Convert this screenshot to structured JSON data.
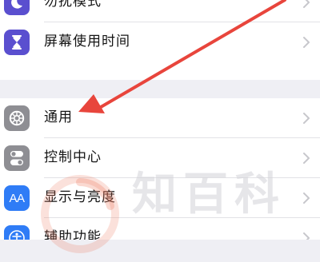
{
  "settings": {
    "group1": [
      {
        "label": "勿扰模式",
        "icon": "moon-icon",
        "icon_color": "#5a4fcf"
      },
      {
        "label": "屏幕使用时间",
        "icon": "hourglass-icon",
        "icon_color": "#5a4fcf"
      }
    ],
    "group2": [
      {
        "label": "通用",
        "icon": "gear-icon",
        "icon_color": "#8e8e93"
      },
      {
        "label": "控制中心",
        "icon": "toggle-icon",
        "icon_color": "#8e8e93"
      },
      {
        "label": "显示与亮度",
        "icon": "text-size-icon",
        "icon_text": "AA",
        "icon_color": "#2f7cf6"
      },
      {
        "label": "辅助功能",
        "icon": "accessibility-icon",
        "icon_color": "#2f7cf6"
      }
    ]
  },
  "annotation": {
    "arrow_color": "#e8453c",
    "target": "通用"
  },
  "watermark": {
    "text": "知百科",
    "logo": "zhibaike-logo"
  },
  "colors": {
    "background": "#efeff4",
    "cell": "#ffffff",
    "separator": "#e2e2e6",
    "chevron": "#c7c7cc"
  }
}
